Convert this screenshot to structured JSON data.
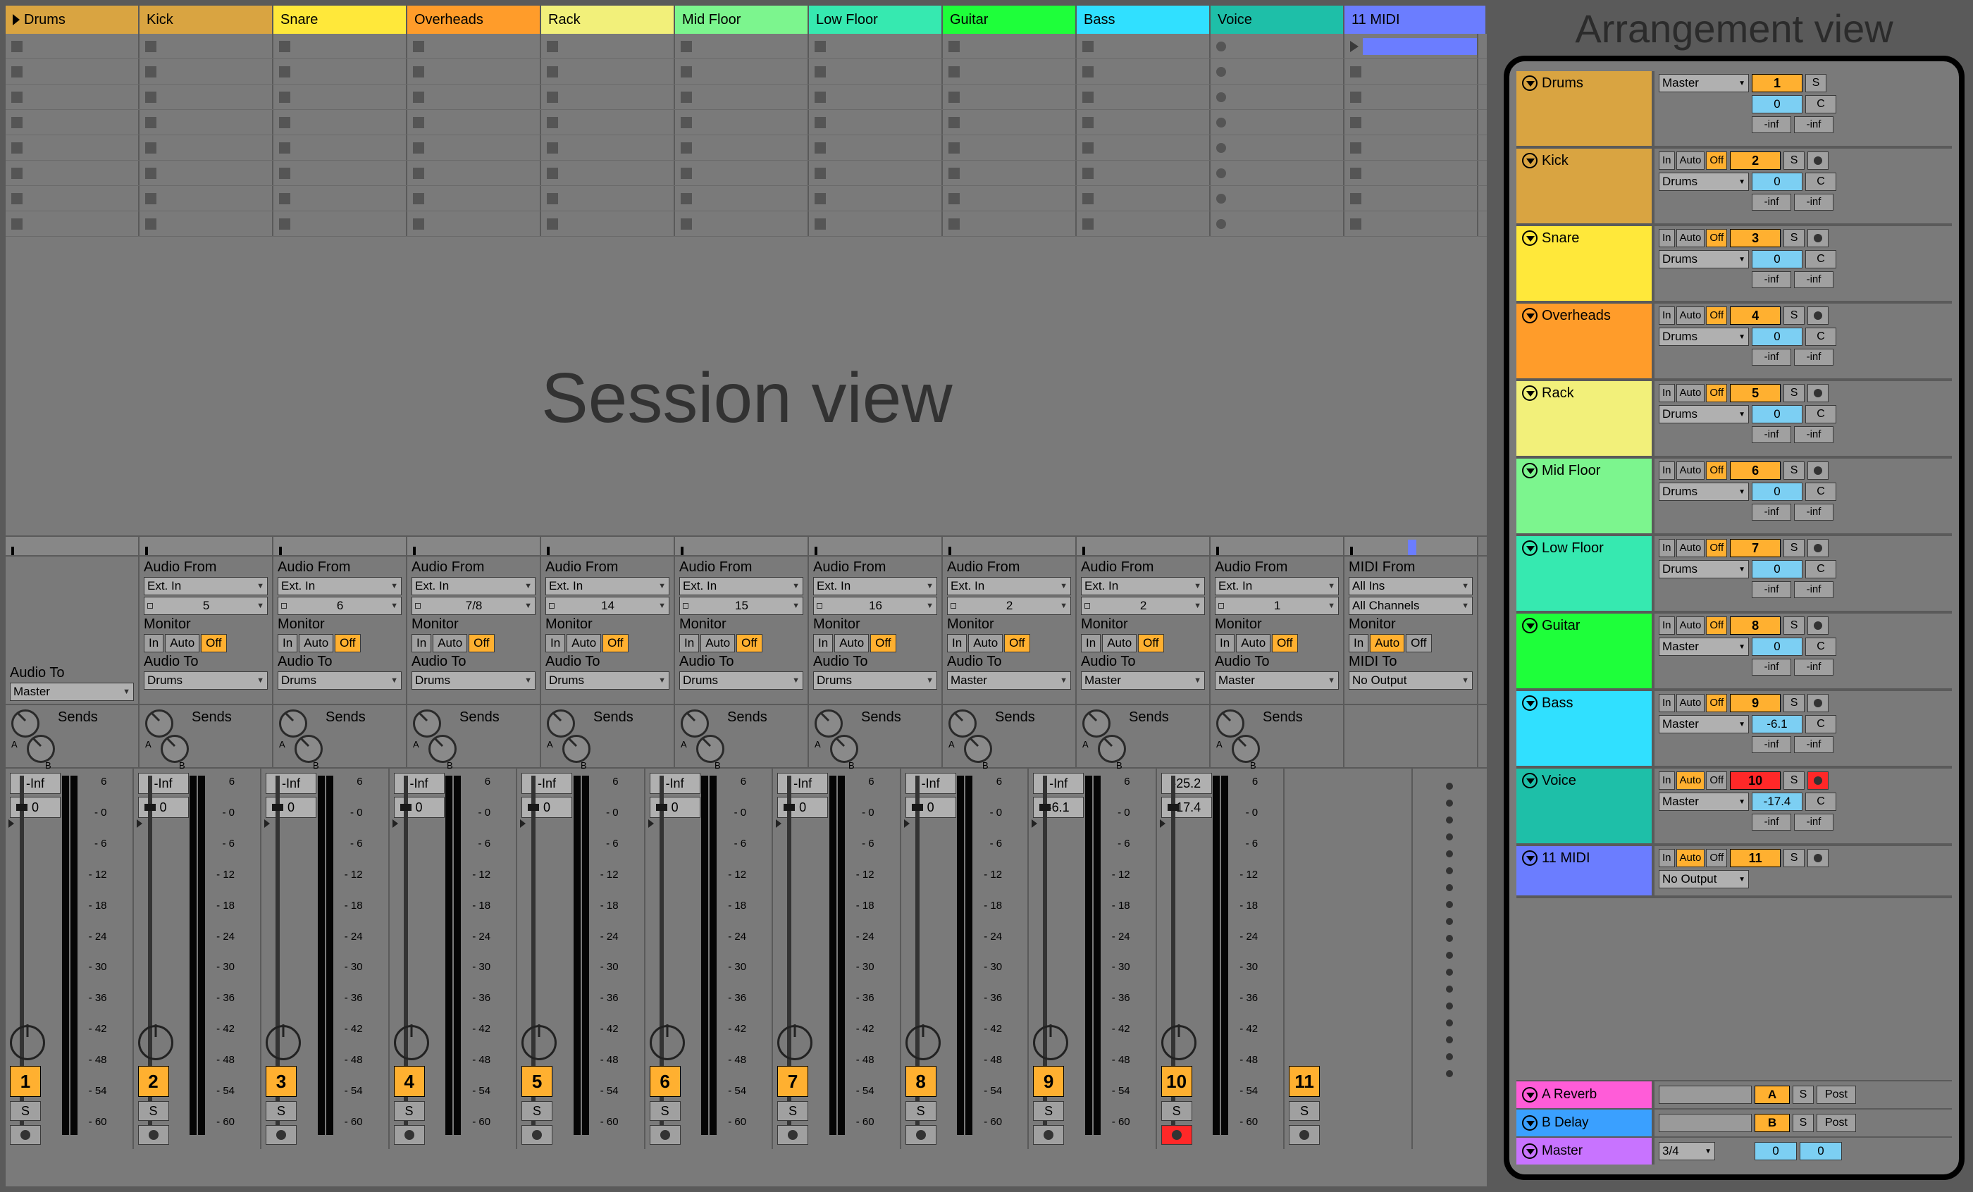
{
  "overlay": {
    "session": "Session view",
    "arrangement": "Arrangement view"
  },
  "tracks": [
    {
      "name": "Drums",
      "color": "#d9a441",
      "num": "1",
      "audio_from": null,
      "ch": null,
      "audio_to": "Master",
      "vol": "-Inf",
      "vol2": "0"
    },
    {
      "name": "Kick",
      "color": "#d9a441",
      "num": "2",
      "audio_from": "Ext. In",
      "ch": "5",
      "audio_to": "Drums",
      "vol": "-Inf",
      "vol2": "0"
    },
    {
      "name": "Snare",
      "color": "#ffe83a",
      "num": "3",
      "audio_from": "Ext. In",
      "ch": "6",
      "audio_to": "Drums",
      "vol": "-Inf",
      "vol2": "0"
    },
    {
      "name": "Overheads",
      "color": "#ff9c2a",
      "num": "4",
      "audio_from": "Ext. In",
      "ch": "7/8",
      "audio_to": "Drums",
      "vol": "-Inf",
      "vol2": "0"
    },
    {
      "name": "Rack",
      "color": "#f2f07a",
      "num": "5",
      "audio_from": "Ext. In",
      "ch": "14",
      "audio_to": "Drums",
      "vol": "-Inf",
      "vol2": "0"
    },
    {
      "name": "Mid Floor",
      "color": "#7cf58e",
      "num": "6",
      "audio_from": "Ext. In",
      "ch": "15",
      "audio_to": "Drums",
      "vol": "-Inf",
      "vol2": "0"
    },
    {
      "name": "Low Floor",
      "color": "#36e9b0",
      "num": "7",
      "audio_from": "Ext. In",
      "ch": "16",
      "audio_to": "Drums",
      "vol": "-Inf",
      "vol2": "0"
    },
    {
      "name": "Guitar",
      "color": "#1eff3a",
      "num": "8",
      "audio_from": "Ext. In",
      "ch": "2",
      "audio_to": "Master",
      "vol": "-Inf",
      "vol2": "0"
    },
    {
      "name": "Bass",
      "color": "#30e0ff",
      "num": "9",
      "audio_from": "Ext. In",
      "ch": "2",
      "audio_to": "Master",
      "vol": "-Inf",
      "vol2": "-6.1"
    },
    {
      "name": "Voice",
      "color": "#1ebfa8",
      "num": "10",
      "audio_from": "Ext. In",
      "ch": "1",
      "audio_to": "Master",
      "vol": "-25.2",
      "vol2": "-17.4"
    },
    {
      "name": "11 MIDI",
      "color": "#6b7dff",
      "num": "11",
      "midi_from": "All Ins",
      "ch": "All Channels",
      "midi_to": "No Output",
      "vol": null,
      "vol2": null
    }
  ],
  "io_labels": {
    "audio_from": "Audio From",
    "midi_from": "MIDI From",
    "monitor": "Monitor",
    "audio_to": "Audio To",
    "midi_to": "MIDI To",
    "mon_in": "In",
    "mon_auto": "Auto",
    "mon_off": "Off",
    "sends": "Sends",
    "solo": "S",
    "inf": "-inf",
    "cue": "C",
    "scale": [
      "6",
      "0",
      "6",
      "12",
      "18",
      "24",
      "30",
      "36",
      "42",
      "48",
      "54",
      "60"
    ]
  },
  "arr": {
    "tracks": [
      {
        "name": "Drums",
        "color": "#d9a441",
        "num": "1",
        "route": "Master",
        "cval": "0",
        "mon": null,
        "rec": false
      },
      {
        "name": "Kick",
        "color": "#d9a441",
        "num": "2",
        "route": "Drums",
        "cval": "0",
        "mon": "off",
        "rec": true
      },
      {
        "name": "Snare",
        "color": "#ffe83a",
        "num": "3",
        "route": "Drums",
        "cval": "0",
        "mon": "off",
        "rec": true
      },
      {
        "name": "Overheads",
        "color": "#ff9c2a",
        "num": "4",
        "route": "Drums",
        "cval": "0",
        "mon": "off",
        "rec": true
      },
      {
        "name": "Rack",
        "color": "#f2f07a",
        "num": "5",
        "route": "Drums",
        "cval": "0",
        "mon": "off",
        "rec": true
      },
      {
        "name": "Mid Floor",
        "color": "#7cf58e",
        "num": "6",
        "route": "Drums",
        "cval": "0",
        "mon": "off",
        "rec": true
      },
      {
        "name": "Low Floor",
        "color": "#36e9b0",
        "num": "7",
        "route": "Drums",
        "cval": "0",
        "mon": "off",
        "rec": true
      },
      {
        "name": "Guitar",
        "color": "#1eff3a",
        "num": "8",
        "route": "Master",
        "cval": "0",
        "mon": "off",
        "rec": true
      },
      {
        "name": "Bass",
        "color": "#30e0ff",
        "num": "9",
        "route": "Master",
        "cval": "-6.1",
        "mon": "off",
        "rec": true
      },
      {
        "name": "Voice",
        "color": "#1ebfa8",
        "num": "10",
        "route": "Master",
        "cval": "-17.4",
        "mon": "auto",
        "rec": true,
        "armed": true
      },
      {
        "name": "11 MIDI",
        "color": "#6b7dff",
        "num": "11",
        "route": "No Output",
        "cval": null,
        "mon": "auto",
        "rec": true
      }
    ],
    "returns": [
      {
        "name": "A Reverb",
        "color": "#ff5cd8",
        "letter": "A"
      },
      {
        "name": "B Delay",
        "color": "#3aa0ff",
        "letter": "B"
      }
    ],
    "master": {
      "name": "Master",
      "color": "#c873ff",
      "sig": "3/4",
      "c1": "0",
      "c2": "0"
    },
    "labels": {
      "post": "Post",
      "solo": "S"
    }
  }
}
